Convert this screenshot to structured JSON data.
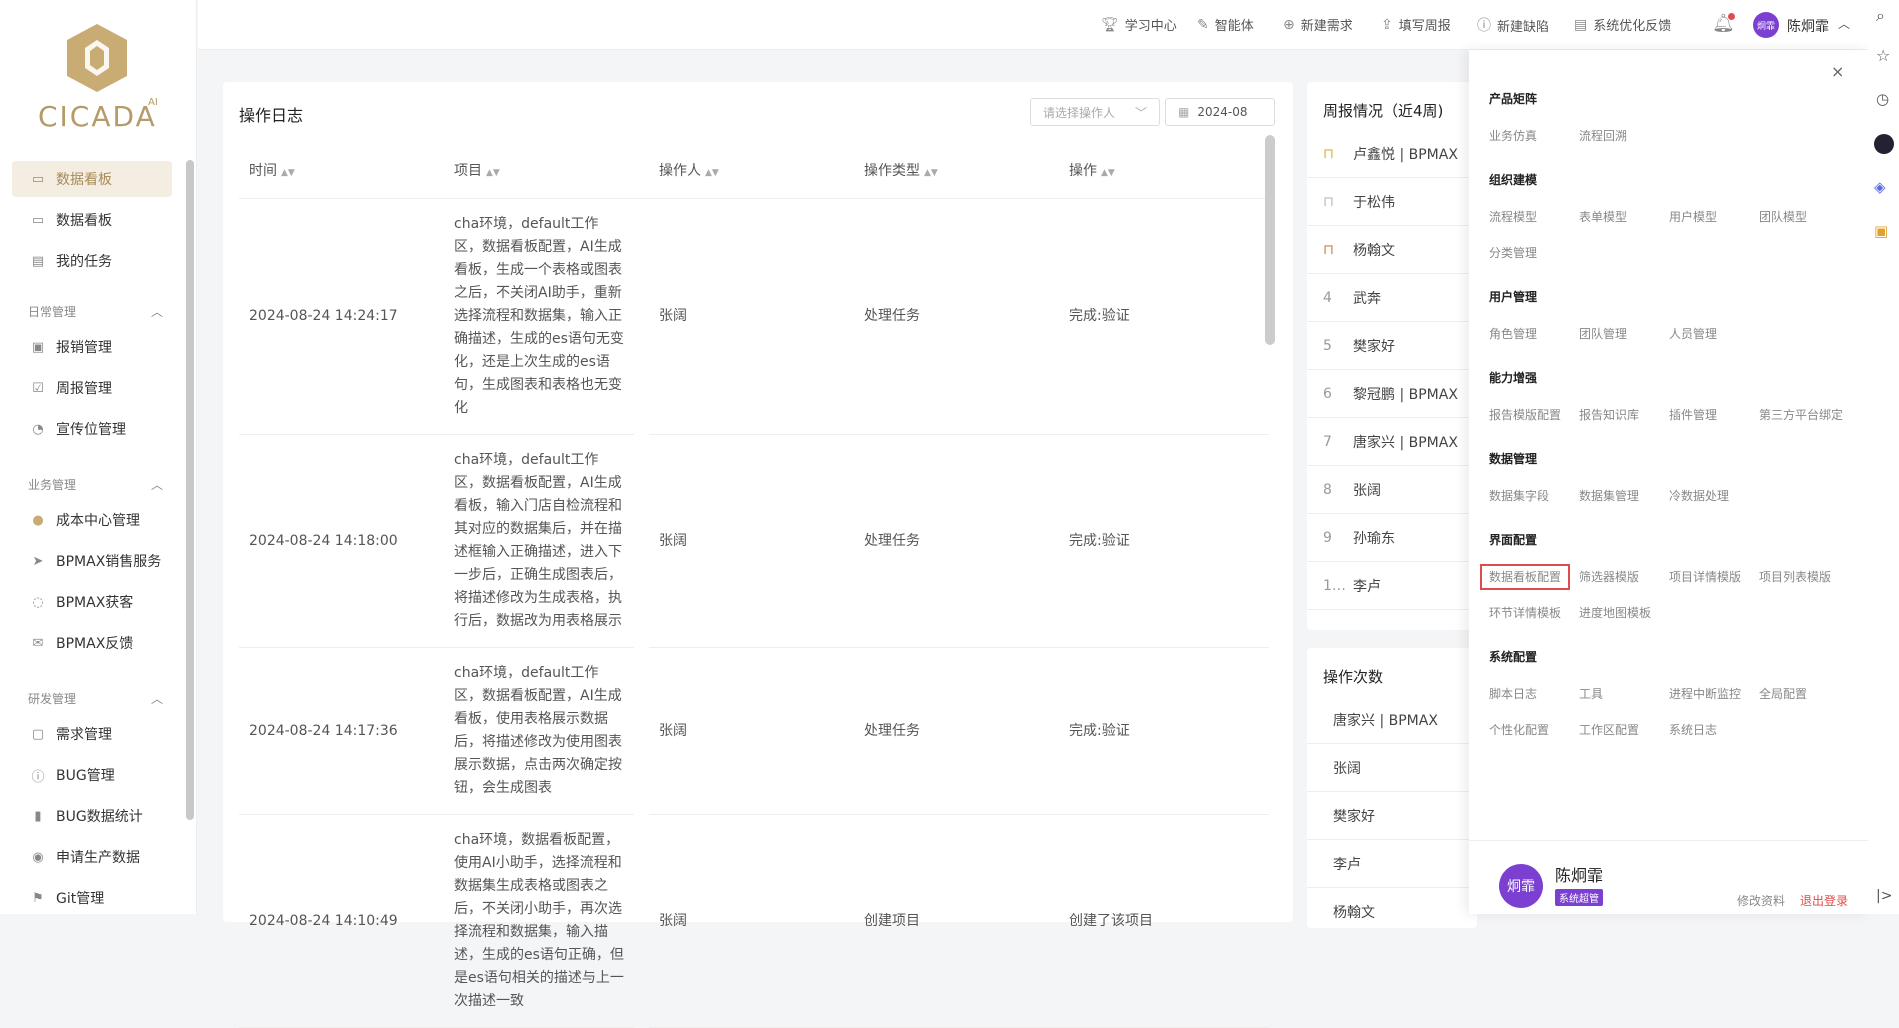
{
  "logo": {
    "text": "CICADA",
    "ai": "AI"
  },
  "sidebar": {
    "items": [
      {
        "label": "数据看板",
        "icon": "dashboard-icon",
        "active": true
      },
      {
        "label": "数据看板",
        "icon": "dashboard-icon"
      },
      {
        "label": "我的任务",
        "icon": "task-icon"
      }
    ],
    "groups": [
      {
        "title": "日常管理",
        "items": [
          {
            "label": "报销管理",
            "icon": "reimburse-icon"
          },
          {
            "label": "周报管理",
            "icon": "weekly-report-icon"
          },
          {
            "label": "宣传位管理",
            "icon": "promo-icon"
          }
        ]
      },
      {
        "title": "业务管理",
        "items": [
          {
            "label": "成本中心管理",
            "icon": "user-icon"
          },
          {
            "label": "BPMAX销售服务",
            "icon": "send-icon"
          },
          {
            "label": "BPMAX获客",
            "icon": "chat-icon"
          },
          {
            "label": "BPMAX反馈",
            "icon": "mail-icon"
          }
        ]
      },
      {
        "title": "研发管理",
        "items": [
          {
            "label": "需求管理",
            "icon": "chip-icon"
          },
          {
            "label": "BUG管理",
            "icon": "alert-icon"
          },
          {
            "label": "BUG数据统计",
            "icon": "bar-chart-icon"
          },
          {
            "label": "申请生产数据",
            "icon": "eye-icon"
          },
          {
            "label": "Git管理",
            "icon": "flag-icon"
          }
        ]
      }
    ]
  },
  "header": {
    "items": [
      {
        "label": "学习中心",
        "icon": "trophy-icon"
      },
      {
        "label": "智能体",
        "icon": "edit-icon"
      },
      {
        "label": "新建需求",
        "icon": "plus-circle-icon"
      },
      {
        "label": "填写周报",
        "icon": "file-upload-icon"
      },
      {
        "label": "新建缺陷",
        "icon": "alert-circle-icon"
      },
      {
        "label": "系统优化反馈",
        "icon": "feedback-icon"
      }
    ],
    "user_name": "陈炯霏",
    "avatar_text": "炯霏"
  },
  "log": {
    "title": "操作日志",
    "operator_placeholder": "请选择操作人",
    "date_value": "2024-08",
    "columns": [
      "时间",
      "项目",
      "操作人",
      "操作类型",
      "操作"
    ],
    "rows": [
      {
        "time": "2024-08-24 14:24:17",
        "project": "cha环境，default工作区，数据看板配置，AI生成看板，生成一个表格或图表之后，不关闭AI助手，重新选择流程和数据集，输入正确描述，生成的es语句无变化，还是上次生成的es语句，生成图表和表格也无变化",
        "operator": "张阔",
        "type": "处理任务",
        "op": "完成:验证"
      },
      {
        "time": "2024-08-24 14:18:00",
        "project": "cha环境，default工作区，数据看板配置，AI生成看板，输入门店自检流程和其对应的数据集后，并在描述框输入正确描述，进入下一步后，正确生成图表后，将描述修改为生成表格，执行后，数据改为用表格展示",
        "operator": "张阔",
        "type": "处理任务",
        "op": "完成:验证"
      },
      {
        "time": "2024-08-24 14:17:36",
        "project": "cha环境，default工作区，数据看板配置，AI生成看板，使用表格展示数据后，将描述修改为使用图表展示数据，点击两次确定按钮，会生成图表",
        "operator": "张阔",
        "type": "处理任务",
        "op": "完成:验证"
      },
      {
        "time": "2024-08-24 14:10:49",
        "project": "cha环境，数据看板配置，使用AI小助手，选择流程和数据集生成表格或图表之后，不关闭小助手，再次选择流程和数据集，输入描述，生成的es语句正确，但是es语句相关的描述与上一次描述一致",
        "operator": "张阔",
        "type": "创建项目",
        "op": "创建了该项目"
      }
    ]
  },
  "weekly": {
    "title": "周报情况（近4周)",
    "rows": [
      {
        "rank": "",
        "name": "卢鑫悦 | BPMAX",
        "icon": "gold-bookmark-icon"
      },
      {
        "rank": "",
        "name": "于松伟",
        "icon": "silver-bookmark-icon"
      },
      {
        "rank": "",
        "name": "杨翰文",
        "icon": "bronze-bookmark-icon"
      },
      {
        "rank": "4",
        "name": "武奔"
      },
      {
        "rank": "5",
        "name": "樊家好"
      },
      {
        "rank": "6",
        "name": "黎冠鹏 | BPMAX"
      },
      {
        "rank": "7",
        "name": "唐家兴 | BPMAX"
      },
      {
        "rank": "8",
        "name": "张阔"
      },
      {
        "rank": "9",
        "name": "孙瑜东"
      },
      {
        "rank": "1…",
        "name": "李卢"
      }
    ]
  },
  "count": {
    "title": "操作次数",
    "rows": [
      "唐家兴 | BPMAX",
      "张阔",
      "樊家好",
      "李卢",
      "杨翰文"
    ]
  },
  "drawer": {
    "sections": [
      {
        "title": "产品矩阵",
        "links": [
          "业务仿真",
          "流程回溯"
        ]
      },
      {
        "title": "组织建模",
        "links": [
          "流程模型",
          "表单模型",
          "用户模型",
          "团队模型",
          "分类管理"
        ]
      },
      {
        "title": "用户管理",
        "links": [
          "角色管理",
          "团队管理",
          "人员管理"
        ]
      },
      {
        "title": "能力增强",
        "links": [
          "报告模版配置",
          "报告知识库",
          "插件管理",
          "第三方平台绑定"
        ]
      },
      {
        "title": "数据管理",
        "links": [
          "数据集字段",
          "数据集管理",
          "冷数据处理"
        ]
      },
      {
        "title": "界面配置",
        "links": [
          "数据看板配置",
          "筛选器模版",
          "项目详情模版",
          "项目列表模版",
          "环节详情模板",
          "进度地图模板"
        ]
      },
      {
        "title": "系统配置",
        "links": [
          "脚本日志",
          "工具",
          "进程中断监控",
          "全局配置",
          "个性化配置",
          "工作区配置",
          "系统日志"
        ]
      }
    ],
    "user_name": "陈炯霏",
    "avatar_text": "炯霏",
    "role_badge": "系统超管",
    "edit_profile": "修改资料",
    "logout": "退出登录"
  },
  "colors": {
    "accent": "#a88b5a",
    "avatar": "#7b3fd1",
    "danger": "#e04b4b"
  }
}
